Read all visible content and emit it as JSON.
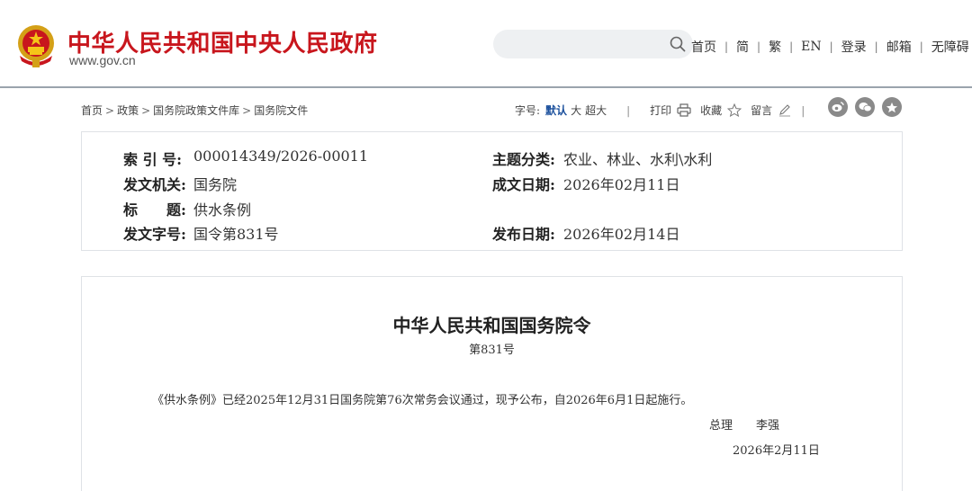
{
  "header": {
    "site_title": "中华人民共和国中央人民政府",
    "site_url": "www.gov.cn",
    "search": {
      "value": "",
      "placeholder": ""
    },
    "nav": [
      "首页",
      "简",
      "繁",
      "EN",
      "登录",
      "邮箱",
      "无障碍"
    ],
    "brand_color": "#c8161d"
  },
  "breadcrumb": {
    "items": [
      "首页",
      "政策",
      "国务院政策文件库",
      "国务院文件"
    ],
    "separator": ">"
  },
  "tools": {
    "font_size_label": "字号:",
    "sizes": [
      "默认",
      "大",
      "超大"
    ],
    "active_size": "默认",
    "print_label": "打印",
    "favorite_label": "收藏",
    "comment_label": "留言",
    "divider": "|",
    "share": [
      "weibo-icon",
      "wechat-icon",
      "favorite-star-icon"
    ]
  },
  "info": {
    "index_label": "索 引 号:",
    "index_value": "000014349/2026-00011",
    "topic_label": "主题分类:",
    "topic_value": "农业、林业、水利\\水利",
    "issuer_label": "发文机关:",
    "issuer_value": "国务院",
    "written_date_label": "成文日期:",
    "written_date_value": "2026年02月11日",
    "title_label": "标　　题:",
    "title_value": "供水条例",
    "doc_number_label": "发文字号:",
    "doc_number_value": "国令第831号",
    "publish_date_label": "发布日期:",
    "publish_date_value": "2026年02月14日"
  },
  "document": {
    "title": "中华人民共和国国务院令",
    "number": "第831号",
    "body": "《供水条例》已经2025年12月31日国务院第76次常务会议通过，现予公布，自2026年6月1日起施行。",
    "signer_title": "总理",
    "signer_name": "李强",
    "date": "2026年2月11日"
  }
}
